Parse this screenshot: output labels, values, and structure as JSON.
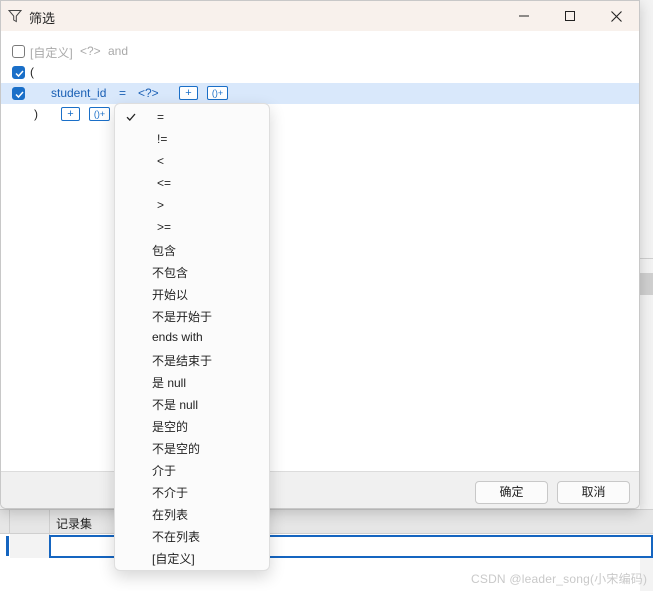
{
  "window": {
    "title": "筛选",
    "icon": "filter-icon"
  },
  "filter": {
    "custom_row": {
      "checked": false,
      "label": "[自定义]",
      "placeholder": "<?>",
      "connector": "and"
    },
    "group_open": {
      "checked": true,
      "text": "("
    },
    "condition": {
      "checked": true,
      "field": "student_id",
      "operator": "=",
      "value": "<?>",
      "add_label": "+",
      "add_group_label": "()+"
    },
    "group_close": {
      "text": ")",
      "add_label": "+",
      "add_group_label": "()+"
    }
  },
  "menu": {
    "selected_index": 0,
    "items": [
      "=",
      "!=",
      "<",
      "<=",
      ">",
      ">=",
      "包含",
      "不包含",
      "开始以",
      "不是开始于",
      "ends with",
      "不是结束于",
      "是 null",
      "不是 null",
      "是空的",
      "不是空的",
      "介于",
      "不介于",
      "在列表",
      "不在列表",
      "[自定义]"
    ]
  },
  "footer": {
    "ok_label": "确定",
    "cancel_label": "取消"
  },
  "background": {
    "grid_column": "记录集",
    "watermark": "CSDN @leader_song(小宋编码)"
  },
  "colors": {
    "accent": "#1a6fc8",
    "selection": "#d9e8fb",
    "titlebar": "#f8f1ec"
  }
}
